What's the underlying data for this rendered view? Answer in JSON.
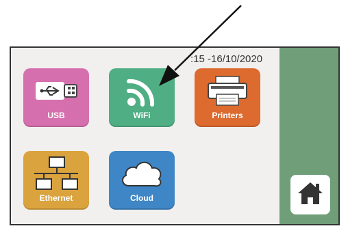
{
  "status": {
    "datetime": ":15 -16/10/2020"
  },
  "tiles": [
    {
      "label": "USB",
      "icon": "usb-icon",
      "color": "#d66fae"
    },
    {
      "label": "WiFi",
      "icon": "wifi-icon",
      "color": "#4fae84"
    },
    {
      "label": "Printers",
      "icon": "printer-icon",
      "color": "#dd6a2e"
    },
    {
      "label": "Ethernet",
      "icon": "ethernet-icon",
      "color": "#dba33d"
    },
    {
      "label": "Cloud",
      "icon": "cloud-icon",
      "color": "#3f86c6"
    }
  ],
  "home": {
    "icon": "home-icon"
  },
  "colors": {
    "screen_bg": "#f1f0ef",
    "side_panel": "#6f9e78"
  },
  "annotation": {
    "icon": "arrow-pointer"
  }
}
